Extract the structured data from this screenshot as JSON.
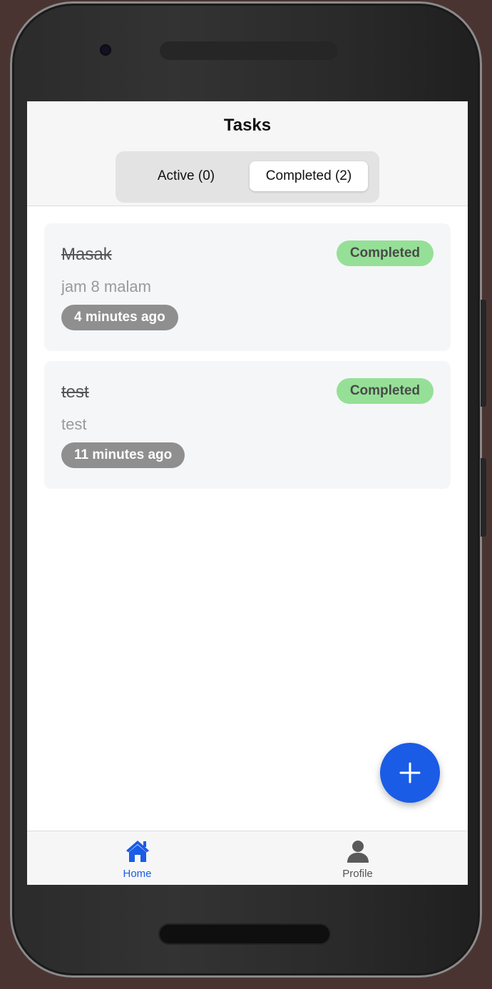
{
  "header": {
    "title": "Tasks",
    "tabs": [
      {
        "label": "Active (0)",
        "selected": false
      },
      {
        "label": "Completed (2)",
        "selected": true
      }
    ]
  },
  "tasks": [
    {
      "title": "Masak",
      "description": "jam 8 malam",
      "time": "4 minutes ago",
      "status": "Completed"
    },
    {
      "title": "test",
      "description": "test",
      "time": "11 minutes ago",
      "status": "Completed"
    }
  ],
  "fab": {
    "icon": "plus-icon"
  },
  "bottom_nav": {
    "items": [
      {
        "label": "Home",
        "icon": "home-icon",
        "active": true
      },
      {
        "label": "Profile",
        "icon": "person-icon",
        "active": false
      }
    ]
  },
  "colors": {
    "accent": "#1a5ce6",
    "completed_badge": "#95e096",
    "time_badge": "#8f8f8f"
  }
}
